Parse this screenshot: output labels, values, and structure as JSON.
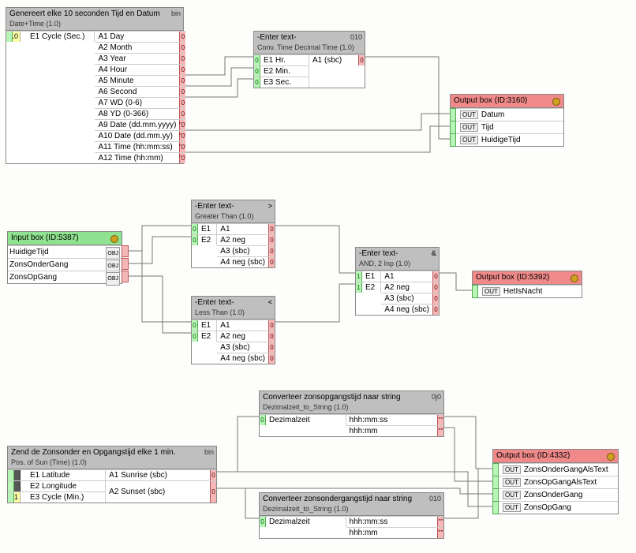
{
  "node1": {
    "title": "Genereert elke 10 seconden Tijd en Datum",
    "sub": "Date+Time (1.0)",
    "typ": "bin",
    "in_chip": "10",
    "in_label": "E1 Cycle (Sec.)",
    "outs": [
      "A1 Day",
      "A2 Month",
      "A3 Year",
      "A4 Hour",
      "A5 Minute",
      "A6 Second",
      "A7 WD (0-6)",
      "A8 YD (0-366)",
      "A9 Date (dd.mm.yyyy)",
      "A10 Date (dd.mm.yy)",
      "A11 Time (hh:mm:ss)",
      "A12 Time (hh:mm)"
    ]
  },
  "node2": {
    "title": "-Enter text-",
    "sub": "Conv. Time Decimal Time (1.0)",
    "typ": "010",
    "ins": [
      "E1 Hr.",
      "E2 Min.",
      "E3 Sec."
    ],
    "out": "A1 (sbc)"
  },
  "node3": {
    "title": "Output box (ID:3160)",
    "rows": [
      "Datum",
      "Tijd",
      "HuidigeTijd"
    ]
  },
  "node4": {
    "title": "Input box (ID:5387)",
    "rows": [
      "HuidigeTijd",
      "ZonsOnderGang",
      "ZonsOpGang"
    ]
  },
  "node5": {
    "title": "-Enter text-",
    "sub": "Greater Than (1.0)",
    "typ": ">",
    "ins": [
      "E1",
      "E2"
    ],
    "outs": [
      "A1",
      "A2 neg",
      "A3 (sbc)",
      "A4 neg (sbc)"
    ]
  },
  "node6": {
    "title": "-Enter text-",
    "sub": "Less Than (1.0)",
    "typ": "<",
    "ins": [
      "E1",
      "E2"
    ],
    "outs": [
      "A1",
      "A2 neg",
      "A3 (sbc)",
      "A4 neg (sbc)"
    ]
  },
  "node7": {
    "title": "-Enter text-",
    "sub": "AND, 2 Inp (1.0)",
    "typ": "&",
    "ins": [
      "E1",
      "E2"
    ],
    "in_chip": "1",
    "outs": [
      "A1",
      "A2 neg",
      "A3 (sbc)",
      "A4 neg (sbc)"
    ]
  },
  "node8": {
    "title": "Output box (ID:5392)",
    "rows": [
      "HetIsNacht"
    ]
  },
  "node9": {
    "title": "Zend de Zonsonder en Opgangstijd elke 1 min.",
    "sub": "Pos. of Sun (Time) (1.0)",
    "typ": "bin",
    "ins": [
      "E1 Latitude",
      "E2 Longitude",
      "E3 Cycle (Min.)"
    ],
    "in_chips": [
      "",
      "",
      "1"
    ],
    "outs": [
      "A1 Sunrise (sbc)",
      "A2 Sunset (sbc)"
    ]
  },
  "node10": {
    "title": "Converteer zonsopgangstijd naar string",
    "sub": "Dezimalzeit_to_String (1.0)",
    "typ": "0j0",
    "in": "Dezimalzeit",
    "outs": [
      "hhh:mm:ss",
      "hhh:mm"
    ]
  },
  "node11": {
    "title": "Converteer zonsondergangstijd naar string",
    "sub": "Dezimalzeit_to_String (1.0)",
    "typ": "010",
    "in": "Dezimalzeit",
    "outs": [
      "hhh:mm:ss",
      "hhh:mm"
    ]
  },
  "node12": {
    "title": "Output box (ID:4332)",
    "rows": [
      "ZonsOnderGangAlsText",
      "ZonsOpGangAlsText",
      "ZonsOnderGang",
      "ZonsOpGang"
    ]
  },
  "out_tag": "OUT",
  "obj_tag": "OBJ"
}
